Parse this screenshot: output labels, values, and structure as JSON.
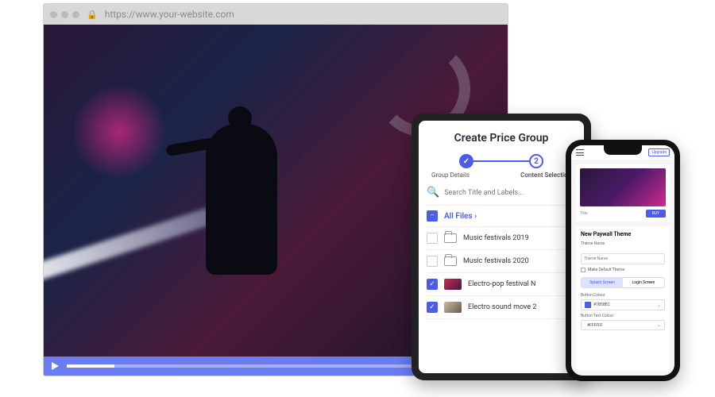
{
  "browser": {
    "url": "https://www.your-website.com"
  },
  "tablet": {
    "title": "Create Price Group",
    "steps": {
      "step1": {
        "label": "Group Details",
        "done": true
      },
      "step2": {
        "label": "Content Selection",
        "number": "2"
      }
    },
    "search_placeholder": "Search Title and Labels...",
    "all_files_label": "All Files ›",
    "files": [
      {
        "type": "folder",
        "label": "Music festivals 2019",
        "checked": false
      },
      {
        "type": "folder",
        "label": "Music festivals 2020",
        "checked": false
      },
      {
        "type": "video",
        "label": "Electro-pop festival N",
        "checked": true
      },
      {
        "type": "video",
        "label": "Electro sound move 2",
        "checked": true
      }
    ]
  },
  "phone": {
    "upgrade_label": "Upgrade",
    "preview_title": "Title",
    "preview_button": "BUY",
    "form_title": "New Paywall Theme",
    "theme_name_label": "Theme Name",
    "theme_name_placeholder": "Theme Name",
    "default_checkbox": "Make Default Theme",
    "tabs": {
      "splash": "Splash Screen",
      "login": "Login Screen"
    },
    "button_color_label": "Button Colour",
    "button_color_value": "#1B58EC",
    "button_text_color_label": "Button Text Colour",
    "button_text_color_value": "#FFFFFF"
  }
}
